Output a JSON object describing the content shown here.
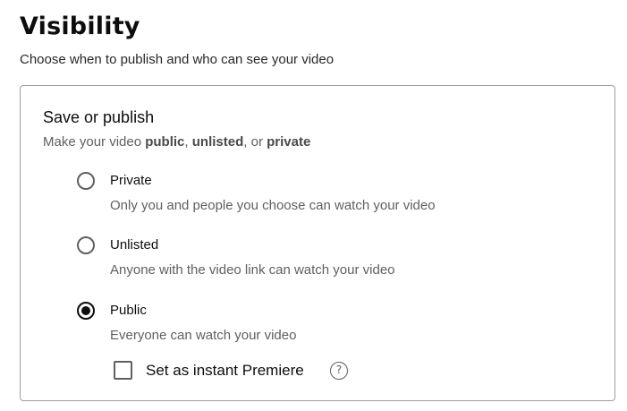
{
  "header": {
    "title": "Visibility",
    "subtitle": "Choose when to publish and who can see your video"
  },
  "card": {
    "title": "Save or publish",
    "subtitle_prefix": "Make your video ",
    "subtitle_public": "public",
    "subtitle_sep1": ", ",
    "subtitle_unlisted": "unlisted",
    "subtitle_sep2": ", or ",
    "subtitle_private": "private",
    "options": [
      {
        "label": "Private",
        "description": "Only you and people you choose can watch your video",
        "selected": false
      },
      {
        "label": "Unlisted",
        "description": "Anyone with the video link can watch your video",
        "selected": false
      },
      {
        "label": "Public",
        "description": "Everyone can watch your video",
        "selected": true
      }
    ],
    "premiere": {
      "label": "Set as instant Premiere",
      "checked": false,
      "help_icon_glyph": "?"
    }
  },
  "icons": {
    "help": "help-circle-icon"
  },
  "colors": {
    "text_primary": "#0d0d0d",
    "text_secondary": "#606060",
    "border": "#9e9e9e"
  }
}
